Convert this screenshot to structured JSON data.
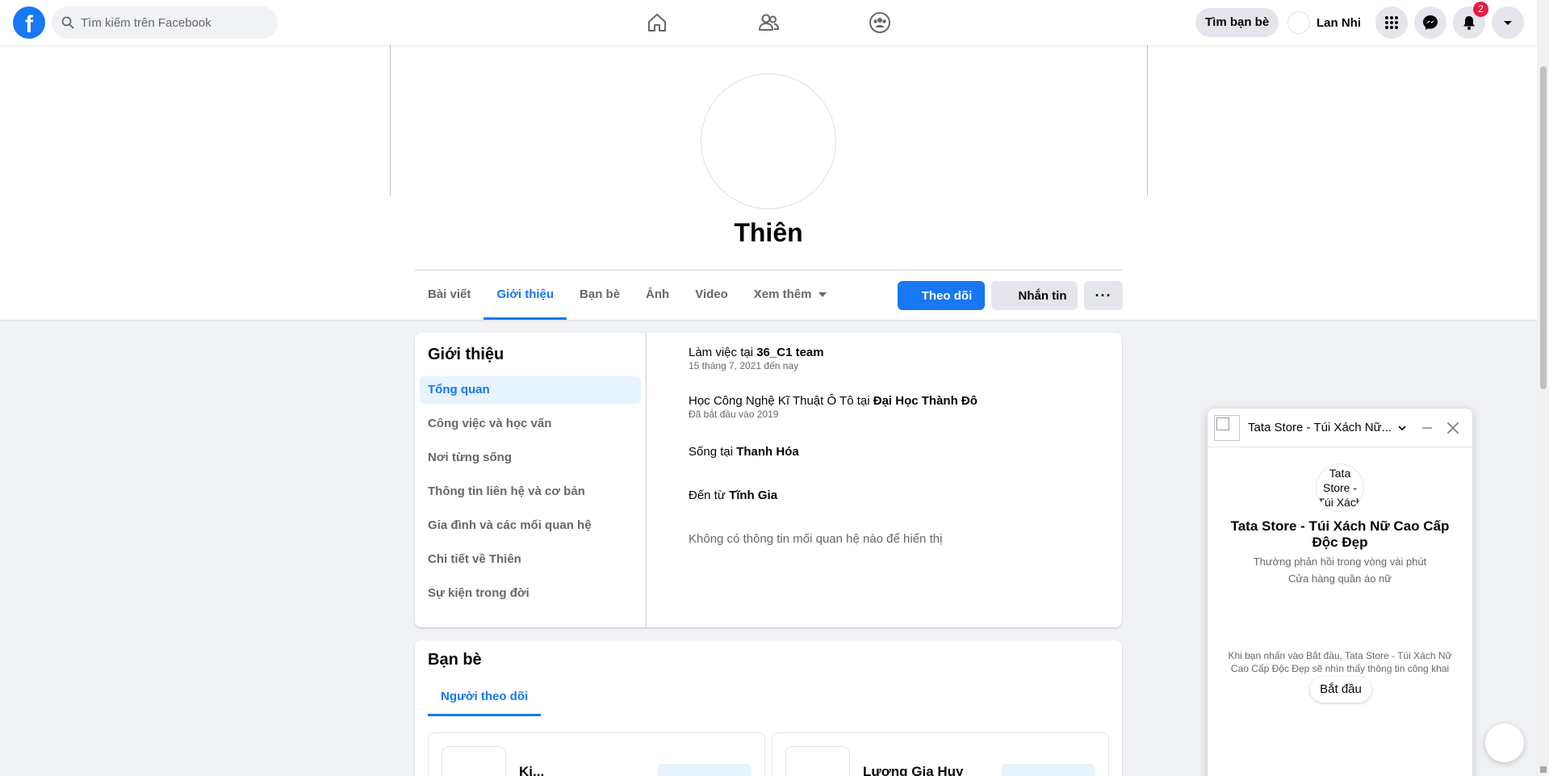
{
  "topbar": {
    "logo_letter": "f",
    "search_placeholder": "Tìm kiếm trên Facebook",
    "nav_icons": [
      "home-icon",
      "friends-icon",
      "groups-icon"
    ],
    "find_friends_label": "Tìm bạn bè",
    "user_name": "Lan Nhi",
    "notification_count": "2",
    "accent_color": "#1877f2"
  },
  "profile": {
    "name": "Thiên",
    "tabs": [
      "Bài viết",
      "Giới thiệu",
      "Bạn bè",
      "Ảnh",
      "Video",
      "Xem thêm"
    ],
    "active_tab": "Giới thiệu",
    "follow_label": "Theo dõi",
    "message_label": "Nhắn tin",
    "more_label": "···"
  },
  "about": {
    "title": "Giới thiệu",
    "nav": [
      "Tổng quan",
      "Công việc và học vấn",
      "Nơi từng sống",
      "Thông tin liên hệ và cơ bản",
      "Gia đình và các mối quan hệ",
      "Chi tiết về Thiên",
      "Sự kiện trong đời"
    ],
    "active_nav": "Tổng quan",
    "work": {
      "prefix": "Làm việc tại ",
      "place": "36_C1 team",
      "sub": "15 tháng 7, 2021 đến nay"
    },
    "education": {
      "prefix": "Học Công Nghệ Kĩ Thuật Ô Tô tại ",
      "place": "Đại Học Thành Đô",
      "sub": "Đã bắt đầu vào 2019"
    },
    "lives": {
      "prefix": "Sống tại ",
      "place": "Thanh Hóa"
    },
    "from": {
      "prefix": "Đến từ ",
      "place": "Tĩnh Gia"
    },
    "relationship": "Không có thông tin mối quan hệ nào để hiển thị"
  },
  "friends": {
    "title": "Bạn bè",
    "tab": "Người theo dõi",
    "items": [
      {
        "name": "Ki..."
      },
      {
        "name": "Lương Gia Huy"
      }
    ]
  },
  "chat": {
    "header_title": "Tata Store - Túi Xách Nữ...",
    "avatar_alt": "Tata Store - Túi Xách",
    "name": "Tata Store - Túi Xách Nữ Cao Cấp Độc Đẹp",
    "response_time": "Thường phản hồi trong vòng vài phút",
    "category": "Cửa hàng quần áo nữ",
    "note": "Khi bạn nhấn vào Bắt đầu, Tata Store - Túi Xách Nữ Cao Cấp Độc Đẹp sẽ nhìn thấy thông tin công khai của bạn.",
    "start_label": "Bắt đầu"
  }
}
